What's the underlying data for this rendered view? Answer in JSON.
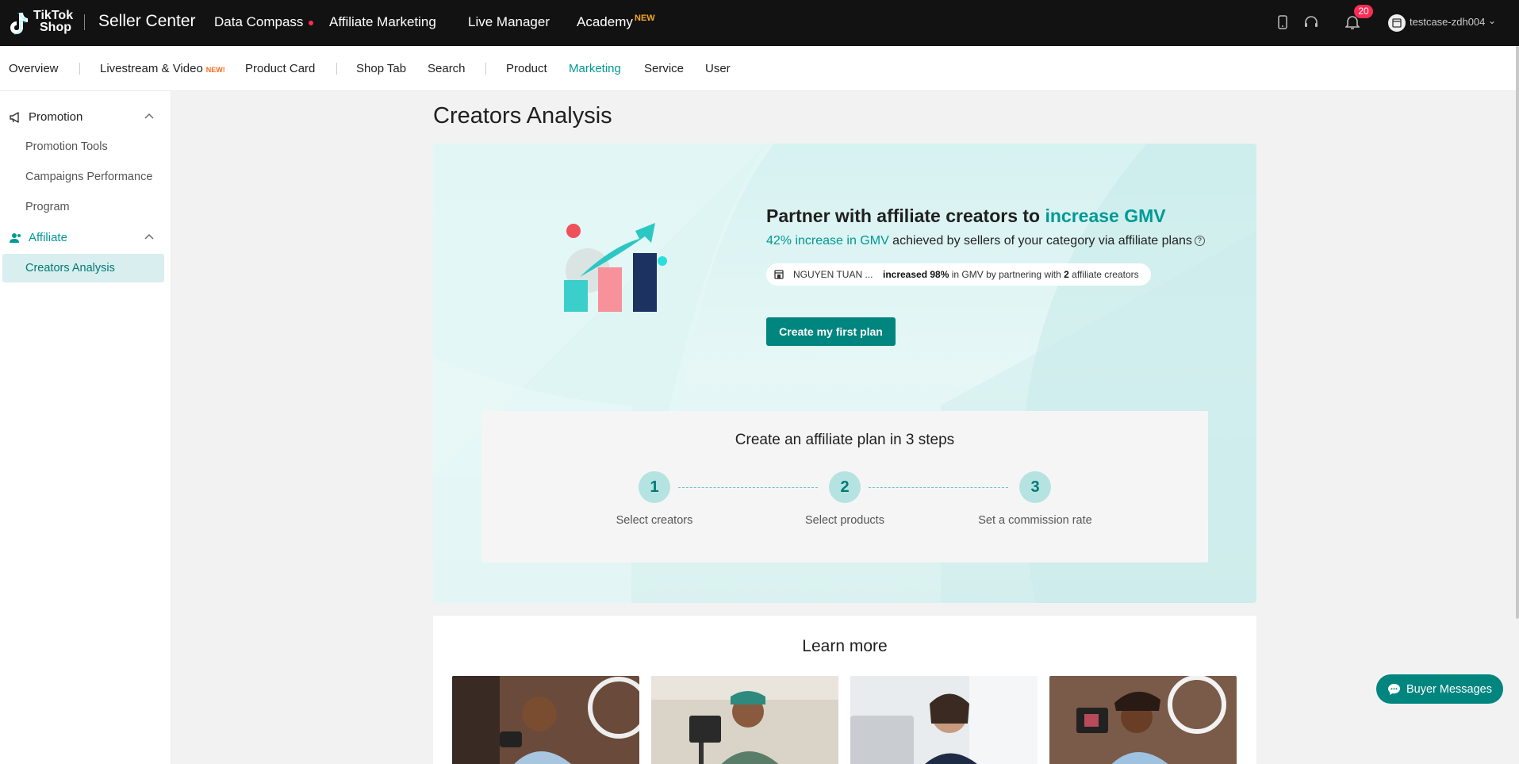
{
  "brand": {
    "logo_line1": "TikTok",
    "logo_line2": "Shop",
    "app_title": "Seller Center"
  },
  "top_nav": [
    {
      "label": "Data Compass"
    },
    {
      "label": "Affiliate Marketing"
    },
    {
      "label": "Live Manager"
    },
    {
      "label": "Academy",
      "badge": "NEW"
    }
  ],
  "top_right": {
    "notification_count": "20",
    "username": "testcase-zdh004",
    "icons": [
      "mobile-icon",
      "headset-icon",
      "bell-icon",
      "shop-icon",
      "chevron-down-icon"
    ]
  },
  "sub_nav": [
    {
      "label": "Overview"
    },
    {
      "label": "Livestream & Video",
      "badge": "NEW!"
    },
    {
      "label": "Product Card"
    },
    {
      "label": "Shop Tab"
    },
    {
      "label": "Search"
    },
    {
      "label": "Product"
    },
    {
      "label": "Marketing",
      "active": true
    },
    {
      "label": "Service"
    },
    {
      "label": "User"
    }
  ],
  "sidebar": {
    "promotion": {
      "label": "Promotion",
      "items": [
        "Promotion Tools",
        "Campaigns Performance",
        "Program"
      ]
    },
    "affiliate": {
      "label": "Affiliate",
      "items": [
        "Creators Analysis"
      ]
    }
  },
  "page_title": "Creators Analysis",
  "hero": {
    "title_prefix": "Partner with affiliate creators to ",
    "title_accent": "increase GMV",
    "sub_accent": "42% increase in GMV",
    "sub_rest": " achieved by sellers of your category via affiliate plans",
    "pill_name": "NGUYEN TUAN ...",
    "pill_increased": "increased 98%",
    "pill_mid": " in GMV by partnering with ",
    "pill_count": "2",
    "pill_tail": " affiliate creators",
    "cta": "Create my first plan"
  },
  "steps": {
    "title": "Create an affiliate plan in 3 steps",
    "items": [
      {
        "num": "1",
        "label": "Select creators"
      },
      {
        "num": "2",
        "label": "Select products"
      },
      {
        "num": "3",
        "label": "Set a commission rate"
      }
    ]
  },
  "learn_more": {
    "title": "Learn more"
  },
  "buyer_messages": "Buyer Messages",
  "colors": {
    "accent": "#009995",
    "button": "#00857f",
    "badge_red": "#fe2c55",
    "new_orange": "#f5a623"
  }
}
